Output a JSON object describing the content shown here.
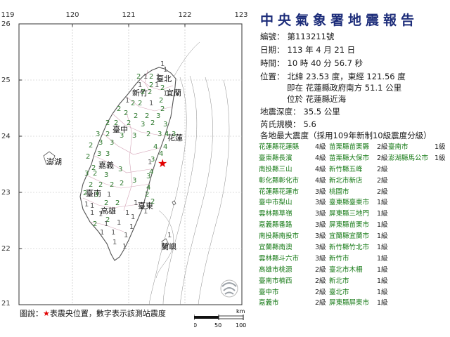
{
  "map": {
    "lon_labels": [
      "119",
      "120",
      "121",
      "122",
      "123"
    ],
    "lat_labels": [
      "26",
      "25",
      "24",
      "23",
      "22",
      "21"
    ],
    "places": [
      "臺北",
      "新竹",
      "宜蘭",
      "臺中",
      "花蓮",
      "澎湖",
      "嘉義",
      "臺南",
      "臺東",
      "高雄",
      "蘭嶼"
    ],
    "epicenter_color": "#e10000",
    "intensity_colors": {
      "1": "#555555",
      "2": "#2f7a2f",
      "3": "#2f7a2f",
      "4": "#2f7a2f"
    },
    "intensities": [
      {
        "v": "1"
      },
      {
        "v": "1"
      },
      {
        "v": "2"
      },
      {
        "v": "1"
      },
      {
        "v": "2"
      },
      {
        "v": "1"
      },
      {
        "v": "1"
      },
      {
        "v": "2"
      },
      {
        "v": "1"
      },
      {
        "v": "2"
      },
      {
        "v": "2"
      },
      {
        "v": "2"
      },
      {
        "v": "1"
      },
      {
        "v": "2"
      },
      {
        "v": "2"
      },
      {
        "v": "1"
      },
      {
        "v": "2"
      },
      {
        "v": "2"
      },
      {
        "v": "2"
      },
      {
        "v": "2"
      },
      {
        "v": "2"
      },
      {
        "v": "3"
      },
      {
        "v": "2"
      },
      {
        "v": "2"
      },
      {
        "v": "2"
      },
      {
        "v": "3"
      },
      {
        "v": "2"
      },
      {
        "v": "3"
      },
      {
        "v": "3"
      },
      {
        "v": "2"
      },
      {
        "v": "3"
      },
      {
        "v": "3"
      },
      {
        "v": "2"
      },
      {
        "v": "3"
      },
      {
        "v": "4"
      },
      {
        "v": "3"
      },
      {
        "v": "2"
      },
      {
        "v": "3"
      },
      {
        "v": "3"
      },
      {
        "v": "4"
      },
      {
        "v": "4"
      },
      {
        "v": "2"
      },
      {
        "v": "3"
      },
      {
        "v": "3"
      },
      {
        "v": "4"
      },
      {
        "v": "3"
      },
      {
        "v": "2"
      },
      {
        "v": "3"
      },
      {
        "v": "2"
      },
      {
        "v": "3"
      },
      {
        "v": "3"
      },
      {
        "v": "4"
      },
      {
        "v": "3"
      },
      {
        "v": "2"
      },
      {
        "v": "2"
      },
      {
        "v": "2"
      },
      {
        "v": "2"
      },
      {
        "v": "3"
      },
      {
        "v": "4"
      },
      {
        "v": "2"
      },
      {
        "v": "3"
      },
      {
        "v": "1"
      },
      {
        "v": "2"
      },
      {
        "v": "1"
      },
      {
        "v": "1"
      },
      {
        "v": "2"
      },
      {
        "v": "2"
      },
      {
        "v": "1"
      },
      {
        "v": "2"
      },
      {
        "v": "1"
      },
      {
        "v": "1"
      },
      {
        "v": "1"
      },
      {
        "v": "2"
      },
      {
        "v": "1"
      },
      {
        "v": "1"
      },
      {
        "v": "2"
      },
      {
        "v": "1"
      },
      {
        "v": "1"
      },
      {
        "v": "1"
      },
      {
        "v": "1"
      },
      {
        "v": "1"
      },
      {
        "v": "1"
      },
      {
        "v": "1"
      },
      {
        "v": "1"
      },
      {
        "v": "1"
      },
      {
        "v": "2"
      },
      {
        "v": "1"
      },
      {
        "v": "1"
      }
    ],
    "legend_note_prefix": "圖說：",
    "legend_note_star": "★",
    "legend_note_text": "表震央位置，數字表示該測站震度",
    "scale": {
      "unit": "km",
      "ticks": [
        "0",
        "50",
        "100"
      ]
    }
  },
  "report": {
    "title": "中央氣象署地震報告",
    "number_label": "編號：",
    "number_value": "第113211號",
    "date_label": "日期：",
    "date_value": "113 年 4 月 21 日",
    "time_label": "時間：",
    "time_value": "10 時 40 分 56.7 秒",
    "position_label": "位置：",
    "position_value": "北緯 23.53 度，東經 121.56 度",
    "location_line1": "即在 花蓮縣政府南方 51.1 公里",
    "location_line2": "位於 花蓮縣近海",
    "depth_label": "地震深度：",
    "depth_value": "35.5 公里",
    "magnitude_label": "芮氏規模：",
    "magnitude_value": "5.6",
    "max_intensity_header": "各地最大震度（採用109年新制10級震度分級）"
  },
  "stations": [
    {
      "r1": "花蓮縣花蓮縣",
      "i1": "4級",
      "r2": "苗栗縣苗栗縣",
      "i2": "2級",
      "r3": "臺南市",
      "i3": "1級"
    },
    {
      "r1": "臺東縣長濱",
      "i1": "4級",
      "r2": "苗栗縣大保市",
      "i2": "2級",
      "r3": "澎湖縣馬公市",
      "i3": "1級"
    },
    {
      "r1": "南投縣三山",
      "i1": "4級",
      "r2": "新竹縣五峰",
      "i2": "2級",
      "r3": "",
      "i3": ""
    },
    {
      "r1": "彰化縣彰化市",
      "i1": "4級",
      "r2": "新北市新店",
      "i2": "2級",
      "r3": "",
      "i3": ""
    },
    {
      "r1": "花蓮縣花蓮市",
      "i1": "3級",
      "r2": "桃園市",
      "i2": "2級",
      "r3": "",
      "i3": ""
    },
    {
      "r1": "臺中市梨山",
      "i1": "3級",
      "r2": "臺東縣臺東市",
      "i2": "1級",
      "r3": "",
      "i3": ""
    },
    {
      "r1": "雲林縣草嶺",
      "i1": "3級",
      "r2": "屏東縣三地門",
      "i2": "1級",
      "r3": "",
      "i3": ""
    },
    {
      "r1": "嘉義縣番路",
      "i1": "3級",
      "r2": "屏東縣苗栗市",
      "i2": "1級",
      "r3": "",
      "i3": ""
    },
    {
      "r1": "南投縣南投市",
      "i1": "3級",
      "r2": "宜蘭縣宜蘭市",
      "i2": "1級",
      "r3": "",
      "i3": ""
    },
    {
      "r1": "宜蘭縣南澳",
      "i1": "3級",
      "r2": "新竹縣竹北市",
      "i2": "1級",
      "r3": "",
      "i3": ""
    },
    {
      "r1": "雲林縣斗六市",
      "i1": "3級",
      "r2": "新竹市",
      "i2": "1級",
      "r3": "",
      "i3": ""
    },
    {
      "r1": "高雄市桃源",
      "i1": "2級",
      "r2": "臺北市木柵",
      "i2": "1級",
      "r3": "",
      "i3": ""
    },
    {
      "r1": "臺南市楠西",
      "i1": "2級",
      "r2": "新北市",
      "i2": "1級",
      "r3": "",
      "i3": ""
    },
    {
      "r1": "臺中市",
      "i1": "2級",
      "r2": "臺北市",
      "i2": "1級",
      "r3": "",
      "i3": ""
    },
    {
      "r1": "嘉義市",
      "i1": "2級",
      "r2": "屏東縣屏東市",
      "i2": "1級",
      "r3": "",
      "i3": ""
    }
  ]
}
